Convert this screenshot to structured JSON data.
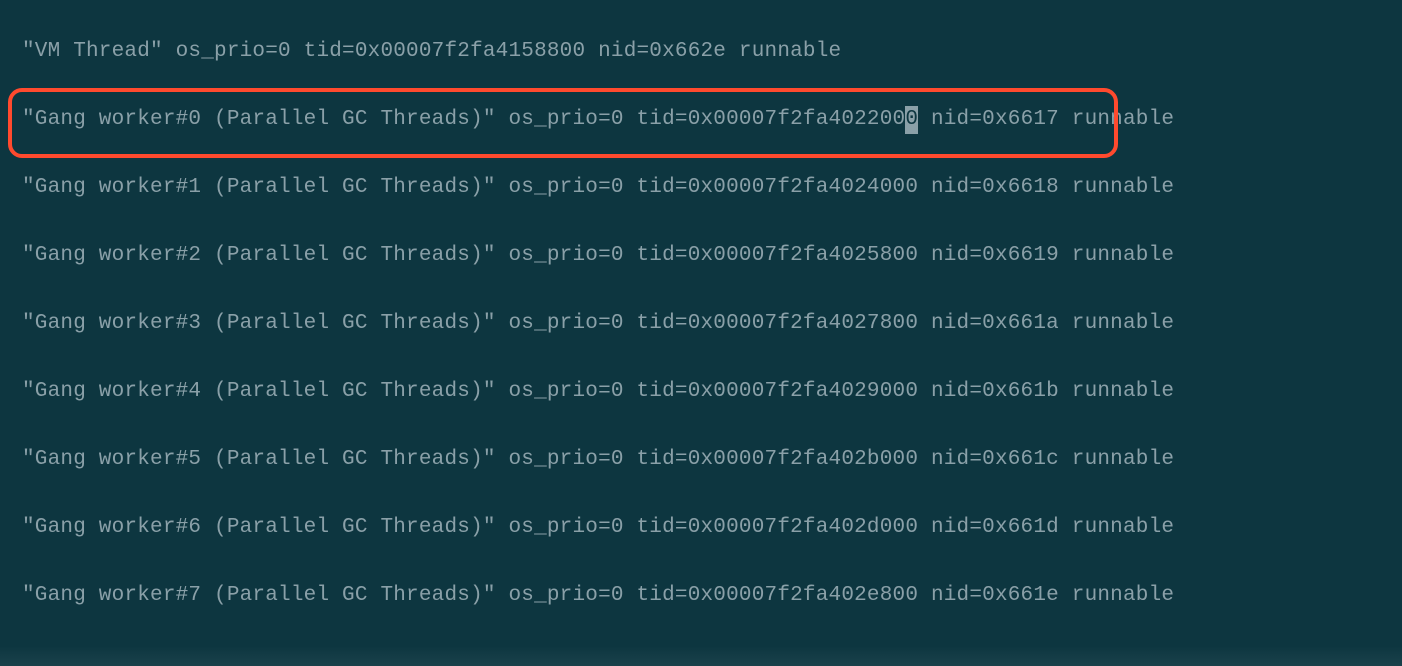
{
  "lines": [
    {
      "text": "\"VM Thread\" os_prio=0 tid=0x00007f2fa4158800 nid=0x662e runnable"
    },
    {
      "text": "\"Gang worker#0 (Parallel GC Threads)\" os_prio=0 tid=0x00007f2fa4022000 nid=0x6617 runnable",
      "cursor_at": 69,
      "highlighted": true
    },
    {
      "text": "\"Gang worker#1 (Parallel GC Threads)\" os_prio=0 tid=0x00007f2fa4024000 nid=0x6618 runnable"
    },
    {
      "text": "\"Gang worker#2 (Parallel GC Threads)\" os_prio=0 tid=0x00007f2fa4025800 nid=0x6619 runnable"
    },
    {
      "text": "\"Gang worker#3 (Parallel GC Threads)\" os_prio=0 tid=0x00007f2fa4027800 nid=0x661a runnable"
    },
    {
      "text": "\"Gang worker#4 (Parallel GC Threads)\" os_prio=0 tid=0x00007f2fa4029000 nid=0x661b runnable"
    },
    {
      "text": "\"Gang worker#5 (Parallel GC Threads)\" os_prio=0 tid=0x00007f2fa402b000 nid=0x661c runnable"
    },
    {
      "text": "\"Gang worker#6 (Parallel GC Threads)\" os_prio=0 tid=0x00007f2fa402d000 nid=0x661d runnable"
    },
    {
      "text": "\"Gang worker#7 (Parallel GC Threads)\" os_prio=0 tid=0x00007f2fa402e800 nid=0x661e runnable"
    }
  ]
}
